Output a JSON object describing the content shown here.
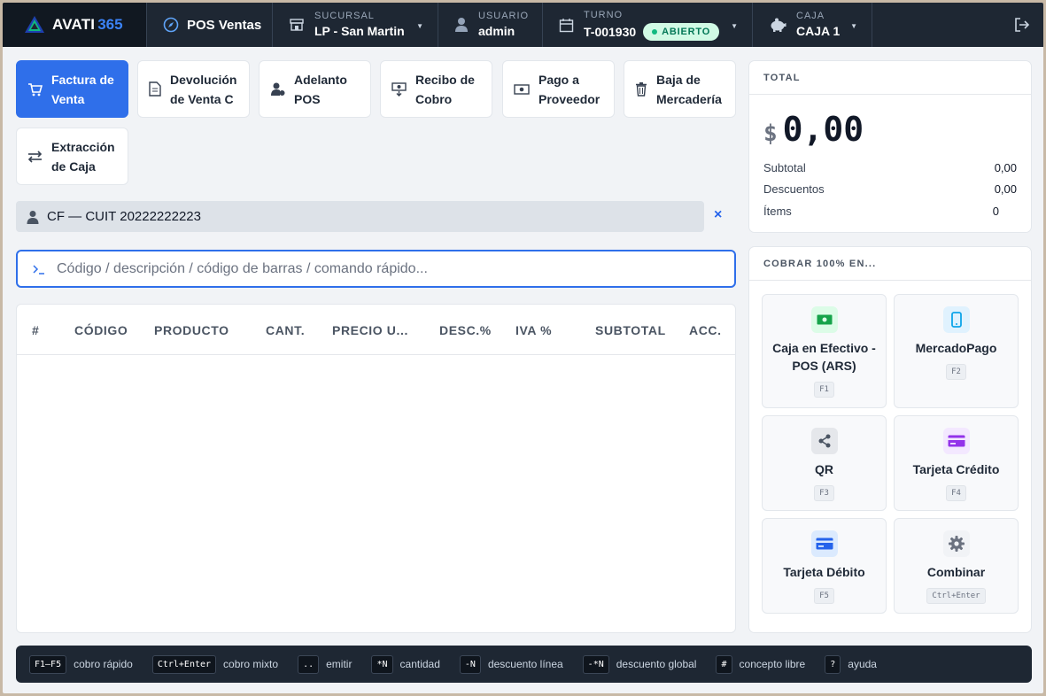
{
  "brand": {
    "name": "AVATI",
    "suffix": "365"
  },
  "module": {
    "label": "POS Ventas"
  },
  "header": {
    "sucursal": {
      "label": "SUCURSAL",
      "value": "LP - San Martin"
    },
    "usuario": {
      "label": "USUARIO",
      "value": "admin"
    },
    "turno": {
      "label": "TURNO",
      "value": "T-001930",
      "status": "ABIERTO"
    },
    "caja": {
      "label": "CAJA",
      "value": "CAJA 1"
    }
  },
  "actions": [
    {
      "label": "Factura de Venta",
      "active": true
    },
    {
      "label": "Devolución de Venta C"
    },
    {
      "label": "Adelanto POS"
    },
    {
      "label": "Recibo de Cobro"
    },
    {
      "label": "Pago a Proveedor"
    },
    {
      "label": "Baja de Mercadería"
    },
    {
      "label": "Extracción de Caja"
    }
  ],
  "client": {
    "text": "CF — CUIT 20222222223",
    "clear": "×"
  },
  "search": {
    "placeholder": "Código / descripción / código de barras / comando rápido..."
  },
  "table": {
    "columns": [
      "#",
      "CÓDIGO",
      "PRODUCTO",
      "CANT.",
      "PRECIO U...",
      "DESC.%",
      "IVA %",
      "SUBTOTAL",
      "ACC."
    ],
    "rows": []
  },
  "totals": {
    "header": "TOTAL",
    "currency": "$",
    "amount": "0,00",
    "subtotal_label": "Subtotal",
    "subtotal": "0,00",
    "descuentos_label": "Descuentos",
    "descuentos": "0,00",
    "items_label": "Ítems",
    "items": "0"
  },
  "payments": {
    "header": "COBRAR 100% EN...",
    "methods": [
      {
        "name": "Caja en Efectivo - POS (ARS)",
        "key": "F1",
        "icon": "cash-icon",
        "color": "#16a34a",
        "bg": "#dcfce7"
      },
      {
        "name": "MercadoPago",
        "key": "F2",
        "icon": "mobile-icon",
        "color": "#0ea5e9",
        "bg": "#e0f2fe"
      },
      {
        "name": "QR",
        "key": "F3",
        "icon": "share-icon",
        "color": "#4b5563",
        "bg": "#e5e7eb"
      },
      {
        "name": "Tarjeta Crédito",
        "key": "F4",
        "icon": "credit-card-icon",
        "color": "#9333ea",
        "bg": "#f3e8ff"
      },
      {
        "name": "Tarjeta Débito",
        "key": "F5",
        "icon": "debit-card-icon",
        "color": "#2563eb",
        "bg": "#dbeafe"
      },
      {
        "name": "Combinar",
        "key": "Ctrl+Enter",
        "icon": "gear-icon",
        "color": "#6b7280",
        "bg": "#f1f3f6"
      }
    ]
  },
  "hints": [
    {
      "key": "F1–F5",
      "desc": "cobro rápido"
    },
    {
      "key": "Ctrl+Enter",
      "desc": "cobro mixto"
    },
    {
      "key": "..",
      "desc": "emitir"
    },
    {
      "key": "*N",
      "desc": "cantidad"
    },
    {
      "key": "-N",
      "desc": "descuento línea"
    },
    {
      "key": "-*N",
      "desc": "descuento global"
    },
    {
      "key": "#",
      "desc": "concepto libre"
    },
    {
      "key": "?",
      "desc": "ayuda"
    }
  ],
  "colors": {
    "accent": "#2f6fea",
    "topbar": "#1e2733",
    "success": "#10b981"
  }
}
